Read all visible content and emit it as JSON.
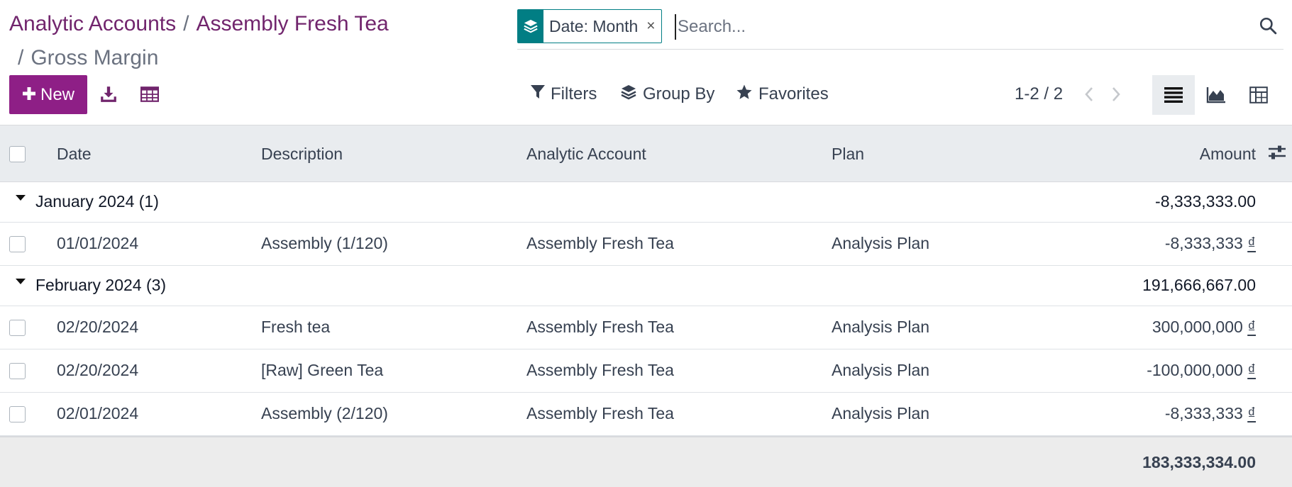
{
  "breadcrumb": {
    "items": [
      "Analytic Accounts",
      "Assembly Fresh Tea"
    ],
    "separator": "/",
    "active": "Gross Margin"
  },
  "search": {
    "facet_label": "Date: Month",
    "facet_close": "×",
    "placeholder": "Search..."
  },
  "toolbar": {
    "new_label": "New",
    "filters_label": "Filters",
    "group_by_label": "Group By",
    "favorites_label": "Favorites"
  },
  "pager": {
    "text": "1-2 / 2"
  },
  "list": {
    "columns": [
      "Date",
      "Description",
      "Analytic Account",
      "Plan",
      "Amount"
    ],
    "groups": [
      {
        "label": "January 2024 (1)",
        "total": "-8,333,333.00",
        "rows": [
          {
            "date": "01/01/2024",
            "description": "Assembly (1/120)",
            "account": "Assembly Fresh Tea",
            "plan": "Analysis Plan",
            "amount": "-8,333,333",
            "currency": "₫"
          }
        ]
      },
      {
        "label": "February 2024 (3)",
        "total": "191,666,667.00",
        "rows": [
          {
            "date": "02/20/2024",
            "description": "Fresh tea",
            "account": "Assembly Fresh Tea",
            "plan": "Analysis Plan",
            "amount": "300,000,000",
            "currency": "₫"
          },
          {
            "date": "02/20/2024",
            "description": "[Raw] Green Tea",
            "account": "Assembly Fresh Tea",
            "plan": "Analysis Plan",
            "amount": "-100,000,000",
            "currency": "₫"
          },
          {
            "date": "02/01/2024",
            "description": "Assembly (2/120)",
            "account": "Assembly Fresh Tea",
            "plan": "Analysis Plan",
            "amount": "-8,333,333",
            "currency": "₫"
          }
        ]
      }
    ],
    "grand_total": "183,333,334.00"
  },
  "colors": {
    "brand": "#71256d",
    "primary_button": "#8e1f86",
    "facet_accent": "#017e84"
  },
  "icons": [
    "layers-icon",
    "search-icon",
    "plus-icon",
    "download-icon",
    "spreadsheet-icon",
    "filter-icon",
    "layers-icon",
    "star-icon",
    "chevron-left-icon",
    "chevron-right-icon",
    "list-view-icon",
    "graph-view-icon",
    "pivot-view-icon",
    "optional-columns-icon",
    "caret-down-icon"
  ]
}
